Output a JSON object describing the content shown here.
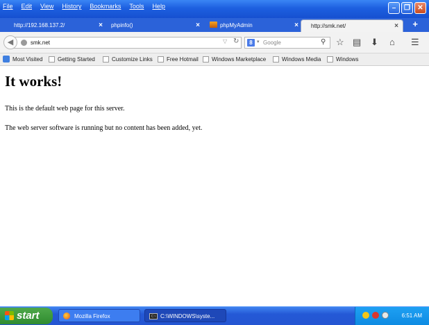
{
  "menu": [
    "File",
    "Edit",
    "View",
    "History",
    "Bookmarks",
    "Tools",
    "Help"
  ],
  "tabs": [
    {
      "label": "http://192.168.137.2/",
      "close": "×"
    },
    {
      "label": "phpinfo()",
      "close": "×"
    },
    {
      "label": "phpMyAdmin",
      "close": "×"
    },
    {
      "label": "http://smk.net/",
      "close": "×"
    }
  ],
  "new_tab": "+",
  "nav": {
    "url": "smk.net",
    "search_placeholder": "Google",
    "search_engine_letter": "8"
  },
  "bookmarks": [
    "Most Visited",
    "Getting Started",
    "Customize Links",
    "Free Hotmail",
    "Windows Marketplace",
    "Windows Media",
    "Windows"
  ],
  "page": {
    "heading": "It works!",
    "para1": "This is the default web page for this server.",
    "para2": "The web server software is running but no content has been added, yet."
  },
  "taskbar": {
    "start": "start",
    "tasks": [
      "Mozilla Firefox",
      "C:\\WINDOWS\\syste..."
    ],
    "clock": "6:51 AM"
  },
  "colors": {
    "titlebar": "#1d5fe0",
    "taskbar": "#2459d6",
    "start_button": "#2f8b2f",
    "tray": "#0e8be2"
  },
  "icons": [
    "back-arrow-icon",
    "globe-icon",
    "reload-icon",
    "search-icon",
    "bookmark-star-icon",
    "reading-list-icon",
    "download-icon",
    "home-icon",
    "menu-icon"
  ]
}
